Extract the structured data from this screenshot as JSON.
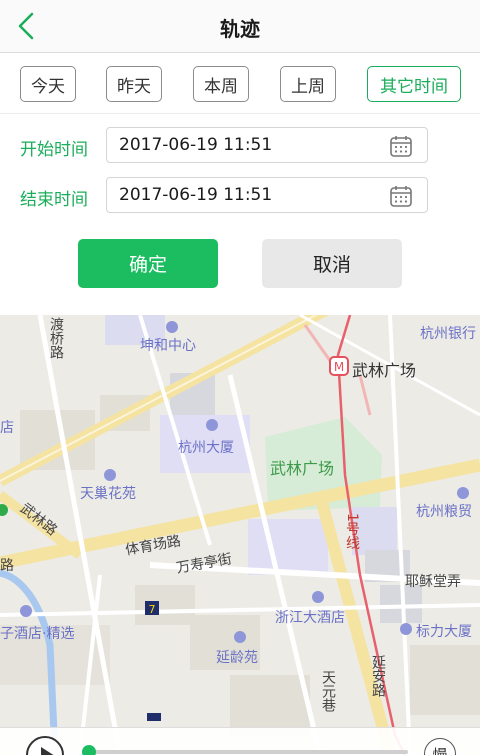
{
  "header": {
    "title": "轨迹"
  },
  "tabs": [
    {
      "label": "今天"
    },
    {
      "label": "昨天"
    },
    {
      "label": "本周"
    },
    {
      "label": "上周"
    },
    {
      "label": "其它时间"
    }
  ],
  "form": {
    "start_label": "开始时间",
    "start_value": "2017-06-19 11:51",
    "end_label": "结束时间",
    "end_value": "2017-06-19 11:51"
  },
  "buttons": {
    "confirm": "确定",
    "cancel": "取消"
  },
  "map": {
    "labels": {
      "dudu_bridge_road": "渡桥路",
      "kunhe_center": "坤和中心",
      "hangzhou_bank": "杭州银行",
      "wulin_square_metro": "武林广场",
      "hangzhou_mansion": "杭州大厦",
      "wulin_square_park": "武林广场",
      "tianchao_garden": "天巢花苑",
      "wulin_road": "武林路",
      "line1": "1号线",
      "hangzhou_grain": "杭州粮贸",
      "tiyuchang_road": "体育场路",
      "shoushou_street": "万寿亭街",
      "yanxian_lane": "耶稣堂弄",
      "zhejiang_hotel": "浙江大酒店",
      "jingxuan_hotel": "子酒店·精选",
      "biaoli_building": "标力大厦",
      "yanling_garden": "延龄苑",
      "yanan_road": "延安路",
      "tianyuan_lane": "天元巷",
      "road_edge": "路",
      "shop_edge": "店"
    },
    "speed_label": "慢",
    "progress": 0.02
  }
}
